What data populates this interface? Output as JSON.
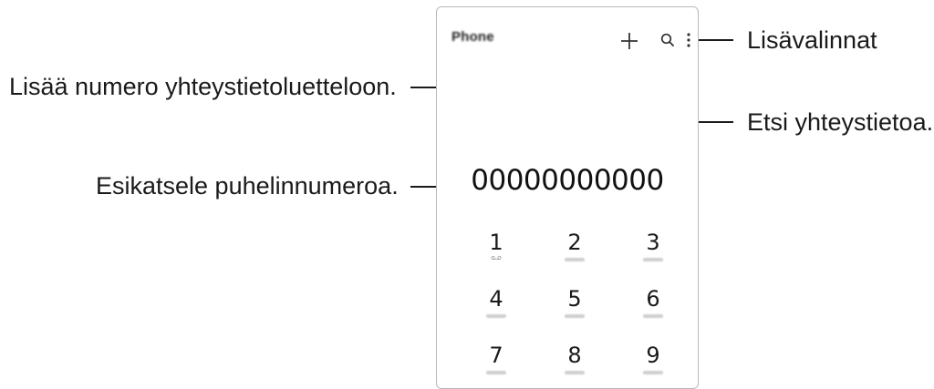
{
  "app": {
    "title": "Phone"
  },
  "toolbar": {
    "add_icon": "plus-icon",
    "search_icon": "search-icon",
    "more_icon": "more-options-icon"
  },
  "dialer": {
    "number": "00000000000",
    "keys": [
      {
        "digit": "1",
        "sub_icon": "voicemail-icon"
      },
      {
        "digit": "2"
      },
      {
        "digit": "3"
      },
      {
        "digit": "4"
      },
      {
        "digit": "5"
      },
      {
        "digit": "6"
      },
      {
        "digit": "7"
      },
      {
        "digit": "8"
      },
      {
        "digit": "9"
      }
    ]
  },
  "callouts": {
    "add_number": "Lisää numero yhteystietoluetteloon.",
    "more_options": "Lisävalinnat",
    "search_contact": "Etsi yhteystietoa.",
    "preview_number": "Esikatsele puhelinnumeroa."
  },
  "colors": {
    "text": "#1a1a1a",
    "frame": "#b9b9b9",
    "leader_line": "#1a1a1a"
  }
}
